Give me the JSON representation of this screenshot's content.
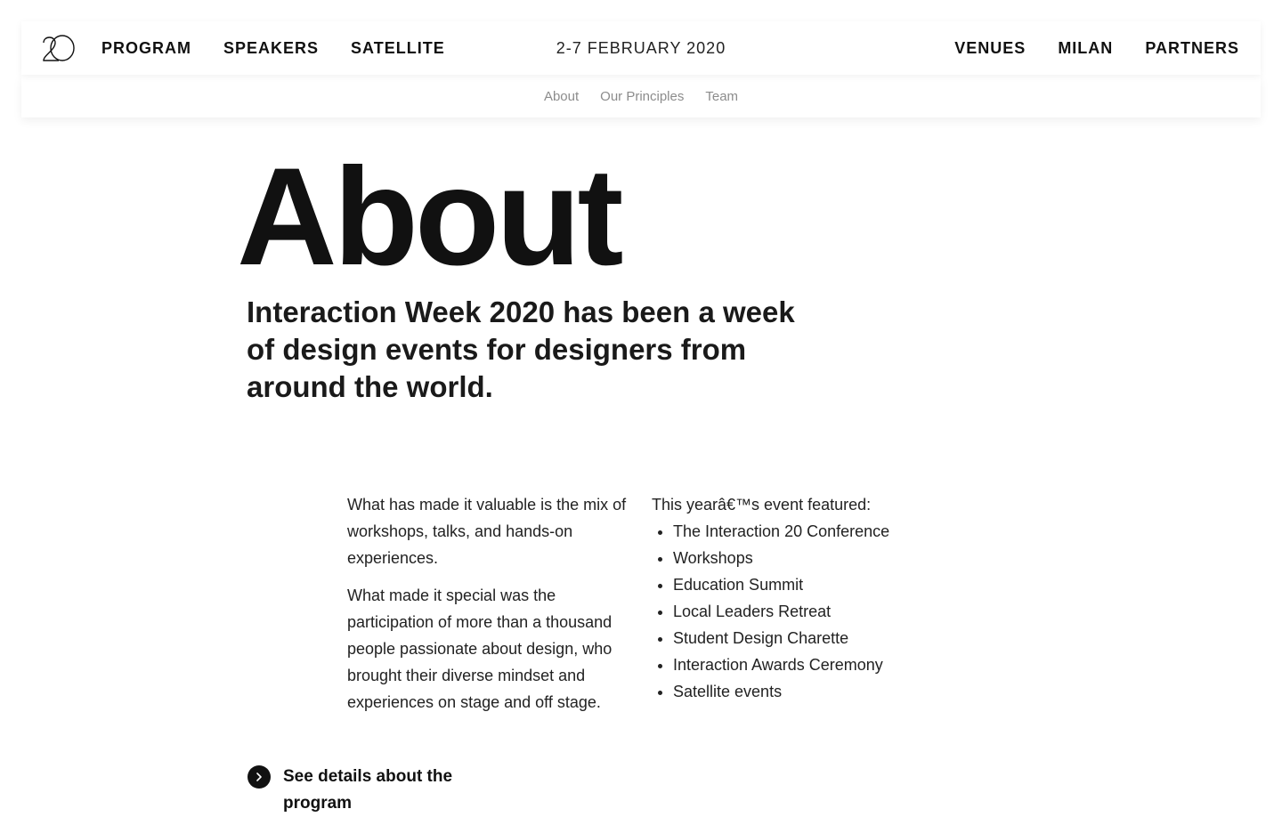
{
  "header": {
    "logo_icon": "interaction20-logo-icon",
    "nav_left": [
      "PROGRAM",
      "SPEAKERS",
      "SATELLITE"
    ],
    "date": "2-7 FEBRUARY 2020",
    "nav_right": [
      "VENUES",
      "MILAN",
      "PARTNERS"
    ]
  },
  "subnav": {
    "items": [
      "About",
      "Our Principles",
      "Team"
    ]
  },
  "hero": {
    "title": "About",
    "subtitle": "Interaction Week 2020 has been a week of design events for designers from around the world."
  },
  "content": {
    "left_paragraphs": [
      "What has made it valuable is the mix of workshops, talks, and hands-on experiences.",
      "What made it special was the participation of more than a thousand people passionate about design, who brought their diverse mindset and experiences on stage and off stage."
    ],
    "right_intro": "This yearâ€™s event featured:",
    "features": [
      "The Interaction 20 Conference",
      "Workshops",
      "Education Summit",
      "Local Leaders Retreat",
      "Student Design Charette",
      "Interaction Awards Ceremony",
      "Satellite events"
    ]
  },
  "cta": {
    "label": "See details about the program",
    "icon": "chevron-right-icon"
  },
  "colors": {
    "text": "#1a1a1a",
    "subnav_text": "#8c8c8c",
    "background": "#ffffff"
  }
}
